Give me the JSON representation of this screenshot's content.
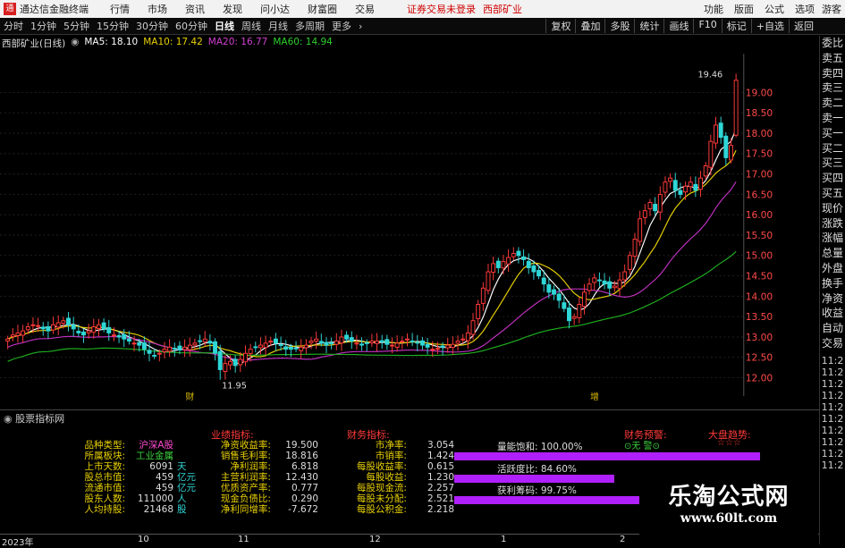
{
  "titlebar": {
    "app_name": "通达信金融终端",
    "menu": [
      "行情",
      "市场",
      "资讯",
      "发现",
      "问小达",
      "财富圈",
      "交易"
    ],
    "notice": "证券交易未登录",
    "stock": "西部矿业",
    "right_menu": [
      "功能",
      "版面",
      "公式",
      "选项"
    ],
    "user": "游客"
  },
  "toolbar": {
    "periods": [
      "分时",
      "1分钟",
      "5分钟",
      "15分钟",
      "30分钟",
      "60分钟",
      "日线",
      "周线",
      "月线",
      "多周期",
      "更多"
    ],
    "active_period": "日线",
    "right_buttons": [
      "复权",
      "叠加",
      "多股",
      "统计",
      "画线",
      "F10",
      "标记",
      "+自选",
      "返回"
    ]
  },
  "ma_line": {
    "stock_title": "西部矿业(日线)",
    "ma5": "MA5: 18.10",
    "ma10": "MA10: 17.42",
    "ma20": "MA20: 16.77",
    "ma60": "MA60: 14.94"
  },
  "chart_data": {
    "type": "candlestick",
    "title": "西部矿业(日线)",
    "yticks": [
      19.0,
      18.5,
      18.0,
      17.5,
      17.0,
      16.5,
      16.0,
      15.5,
      15.0,
      14.5,
      14.0,
      13.5,
      13.0,
      12.5,
      12.0
    ],
    "ylim": [
      11.55,
      19.95
    ],
    "high_label": "19.46",
    "low_label": "11.95",
    "markers": [
      "财",
      "增"
    ],
    "x_labels": [
      "2023年",
      "10",
      "11",
      "12",
      "1",
      "2"
    ],
    "close": [
      12.95,
      13.05,
      13.1,
      13.15,
      13.25,
      13.3,
      13.28,
      13.2,
      13.15,
      13.3,
      13.35,
      13.4,
      13.3,
      13.2,
      13.1,
      13.05,
      13.15,
      13.25,
      13.3,
      13.2,
      13.1,
      13.05,
      13.0,
      12.95,
      12.9,
      12.85,
      12.8,
      12.7,
      12.6,
      12.55,
      12.6,
      12.7,
      12.75,
      12.72,
      12.68,
      12.75,
      12.8,
      12.85,
      12.9,
      12.95,
      12.85,
      12.6,
      12.2,
      12.35,
      12.4,
      12.3,
      12.45,
      12.6,
      12.7,
      12.75,
      12.8,
      12.85,
      12.9,
      12.85,
      12.8,
      12.7,
      12.7,
      12.72,
      12.75,
      12.8,
      12.9,
      12.95,
      12.85,
      12.8,
      12.85,
      12.9,
      13.0,
      12.95,
      12.9,
      12.85,
      12.8,
      12.85,
      12.9,
      12.9,
      12.88,
      12.82,
      12.8,
      12.85,
      12.9,
      12.95,
      12.9,
      12.85,
      12.8,
      12.75,
      12.7,
      12.72,
      12.75,
      12.8,
      12.82,
      12.9,
      12.95,
      13.1,
      13.4,
      13.8,
      14.2,
      14.6,
      14.8,
      14.7,
      14.85,
      14.95,
      15.05,
      15.0,
      14.9,
      14.7,
      14.6,
      14.5,
      14.3,
      14.1,
      14.05,
      13.9,
      13.7,
      13.4,
      13.5,
      13.8,
      14.1,
      14.3,
      14.45,
      14.4,
      14.3,
      14.2,
      14.25,
      14.4,
      14.6,
      15.0,
      15.4,
      15.9,
      16.1,
      16.3,
      16.1,
      16.5,
      16.8,
      16.9,
      16.6,
      16.5,
      16.7,
      16.8,
      16.6,
      16.9,
      17.2,
      17.8,
      18.2,
      17.9,
      17.4,
      17.7,
      19.3
    ],
    "ma_series": [
      "MA5",
      "MA10",
      "MA20",
      "MA60"
    ]
  },
  "indicator": {
    "title": "股票指标网",
    "col1_labels": [
      "品种类型:",
      "所属板块:",
      "上市天数:",
      "股总市值:",
      "流通市值:",
      "股东人数:",
      "人均持股:"
    ],
    "col1_values": [
      "沪深A股",
      "工业金属",
      "6091",
      "459",
      "459",
      "111000",
      "21468"
    ],
    "col1_units": [
      "",
      "",
      "天",
      "亿元",
      "亿元",
      "人",
      "股"
    ],
    "col2_header": "业绩指标:",
    "col2_labels": [
      "净资收益率:",
      "销售毛利率:",
      "净利润率:",
      "主营利润率:",
      "优质资产率:",
      "现金负债比:",
      "净利同增率:"
    ],
    "col2_values": [
      "19.500",
      "18.816",
      "6.818",
      "12.430",
      "0.777",
      "0.290",
      "-7.672"
    ],
    "col3_header": "财务指标:",
    "col3_labels": [
      "市净率:",
      "市销率:",
      "每股收益率:",
      "每股收益:",
      "每股现金流:",
      "每股未分配:",
      "每股公积金:"
    ],
    "col3_values": [
      "3.054",
      "1.424",
      "0.615",
      "1.230",
      "2.257",
      "2.521",
      "2.218"
    ],
    "bars": [
      {
        "label": "量能饱和:",
        "value": "100.00%",
        "fill": 1.0
      },
      {
        "label": "活跃度比:",
        "value": "84.60%",
        "fill": 0.846
      },
      {
        "label": "获利筹码:",
        "value": "99.75%",
        "fill": 0.9975
      }
    ],
    "warn_header": "财务预警:",
    "warn_value": "⊙无 警⊙",
    "trend_header": "大盘趋势:",
    "trend_value": "☆☆☆"
  },
  "right_panel": {
    "items": [
      "委比",
      "卖五",
      "卖四",
      "卖三",
      "卖二",
      "卖一",
      "买一",
      "买二",
      "买三",
      "买四",
      "买五",
      "现价",
      "涨跌",
      "涨幅",
      "总量",
      "外盘",
      "换手",
      "净资",
      "收益",
      "自动",
      "交易"
    ],
    "times": [
      "11:2",
      "11:2",
      "11:2",
      "11:2",
      "11:2",
      "11:2",
      "11:2",
      "11:2",
      "11:2",
      "11:2"
    ]
  },
  "watermark": {
    "line1": "乐淘公式网",
    "line2": "www.60lt.com"
  },
  "colors": {
    "up": "#ff3a3a",
    "down": "#2fd6d6",
    "ma5": "#ffffff",
    "ma10": "#e8d000",
    "ma20": "#c030c0",
    "ma60": "#1fb01f"
  }
}
